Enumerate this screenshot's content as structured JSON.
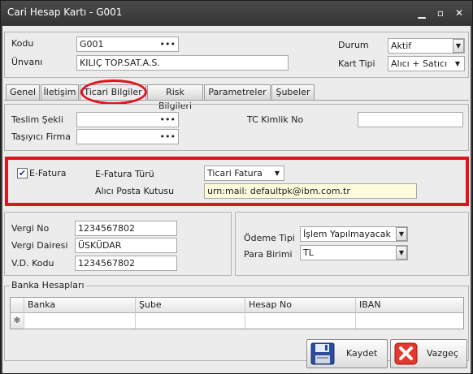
{
  "window": {
    "title": "Cari Hesap Kartı - G001",
    "controls": {
      "minimize": "▁",
      "maximize": "▫",
      "close": "✕"
    }
  },
  "header": {
    "kodu_label": "Kodu",
    "kodu_value": "G001",
    "unvani_label": "Ünvanı",
    "unvani_value": "KILIÇ TOP.SAT.A.S.",
    "durum_label": "Durum",
    "durum_value": "Aktif",
    "kart_tipi_label": "Kart Tipi",
    "kart_tipi_value": "Alıcı + Satıcı"
  },
  "tabs": [
    {
      "label": "Genel"
    },
    {
      "label": "İletişim"
    },
    {
      "label": "Ticari Bilgiler"
    },
    {
      "label": "Risk Bilgileri"
    },
    {
      "label": "Parametreler"
    },
    {
      "label": "Şubeler"
    }
  ],
  "active_tab": "Ticari Bilgiler",
  "shipping": {
    "teslim_sekli_label": "Teslim Şekli",
    "tasiyici_firma_label": "Taşıyıcı Firma",
    "tc_kimlik_label": "TC Kimlik No",
    "teslim_sekli_value": "",
    "tasiyici_firma_value": "",
    "tc_kimlik_value": ""
  },
  "efatura": {
    "checkbox_label": "E-Fatura",
    "checked": true,
    "check_glyph": "✔",
    "turu_label": "E-Fatura Türü",
    "turu_value": "Ticari Fatura",
    "posta_kutusu_label": "Alıcı Posta Kutusu",
    "posta_kutusu_value": "urn:mail: defaultpk@ibm.com.tr"
  },
  "tax": {
    "vergi_no_label": "Vergi No",
    "vergi_no_value": "1234567802",
    "vergi_dairesi_label": "Vergi Dairesi",
    "vergi_dairesi_value": "ÜSKÜDAR",
    "vd_kodu_label": "V.D. Kodu",
    "vd_kodu_value": "1234567802"
  },
  "payment": {
    "odeme_tipi_label": "Ödeme Tipi",
    "odeme_tipi_value": "İşlem Yapılmayacak",
    "para_birimi_label": "Para Birimi",
    "para_birimi_value": "TL"
  },
  "bank": {
    "group_label": "Banka Hesapları",
    "columns": [
      "Banka",
      "Şube",
      "Hesap No",
      "IBAN"
    ],
    "new_row_marker": "✻"
  },
  "buttons": {
    "save_label": "Kaydet",
    "cancel_label": "Vazgeç"
  },
  "glyphs": {
    "ellipsis": "•••",
    "dropdown": "▼"
  },
  "colors": {
    "highlight": "#e0131f",
    "title_bar": "#3a3a3a",
    "required_field": "#fefbdc"
  }
}
